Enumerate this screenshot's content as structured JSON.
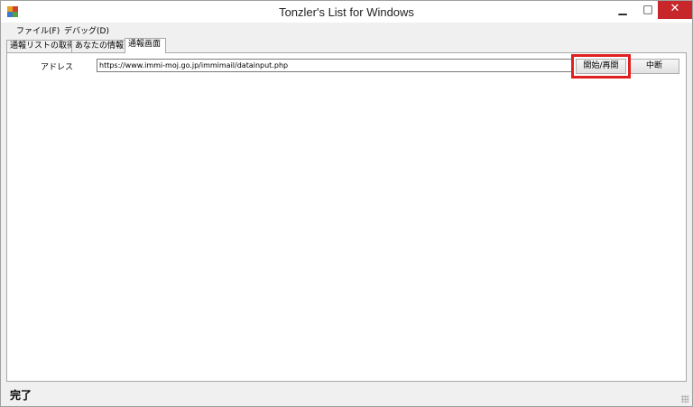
{
  "window": {
    "title": "Tonzler's List for Windows"
  },
  "menu": {
    "items": [
      "ファイル(F)",
      "デバッグ(D)"
    ]
  },
  "tabs": [
    {
      "label": "通報リストの取得",
      "active": false
    },
    {
      "label": "あなたの情報",
      "active": false
    },
    {
      "label": "通報画面",
      "active": true
    }
  ],
  "form": {
    "address_label": "アドレス",
    "address_value": "https://www.immi-moj.go.jp/immimail/datainput.php",
    "start_button": "開始/再開",
    "stop_button": "中断"
  },
  "status": {
    "text": "完了"
  },
  "colors": {
    "highlight": "#e02020",
    "close_button": "#c7272b"
  }
}
